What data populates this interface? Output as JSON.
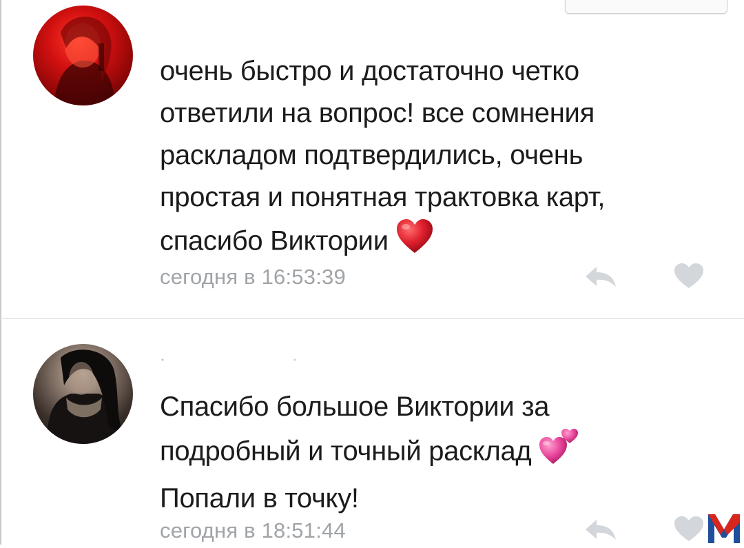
{
  "comments": [
    {
      "lines": [
        "очень быстро и достаточно четко",
        "ответили на вопрос! все сомнения",
        "раскладом подтвердились, очень",
        "простая и понятная трактовка карт,",
        "спасибо Виктории"
      ],
      "emoji": "red-heart",
      "timestamp": "сегодня в 16:53:39"
    },
    {
      "lines": [
        "Спасибо большое Виктории за",
        "подробный и точный расклад",
        "Попали в точку!"
      ],
      "emoji": "two-hearts",
      "timestamp": "сегодня в 18:51:44"
    }
  ],
  "icons": {
    "reply": "reply-arrow-icon",
    "like": "heart-icon",
    "watermark": "m-logo"
  },
  "colors": {
    "text": "#1c1c1c",
    "meta": "#a0a4a8",
    "icon": "#d3d6da",
    "heart_red": "#e0202e",
    "heart_pink": "#e8459a",
    "logo_red": "#d7261e",
    "logo_blue": "#1f4e9c"
  }
}
